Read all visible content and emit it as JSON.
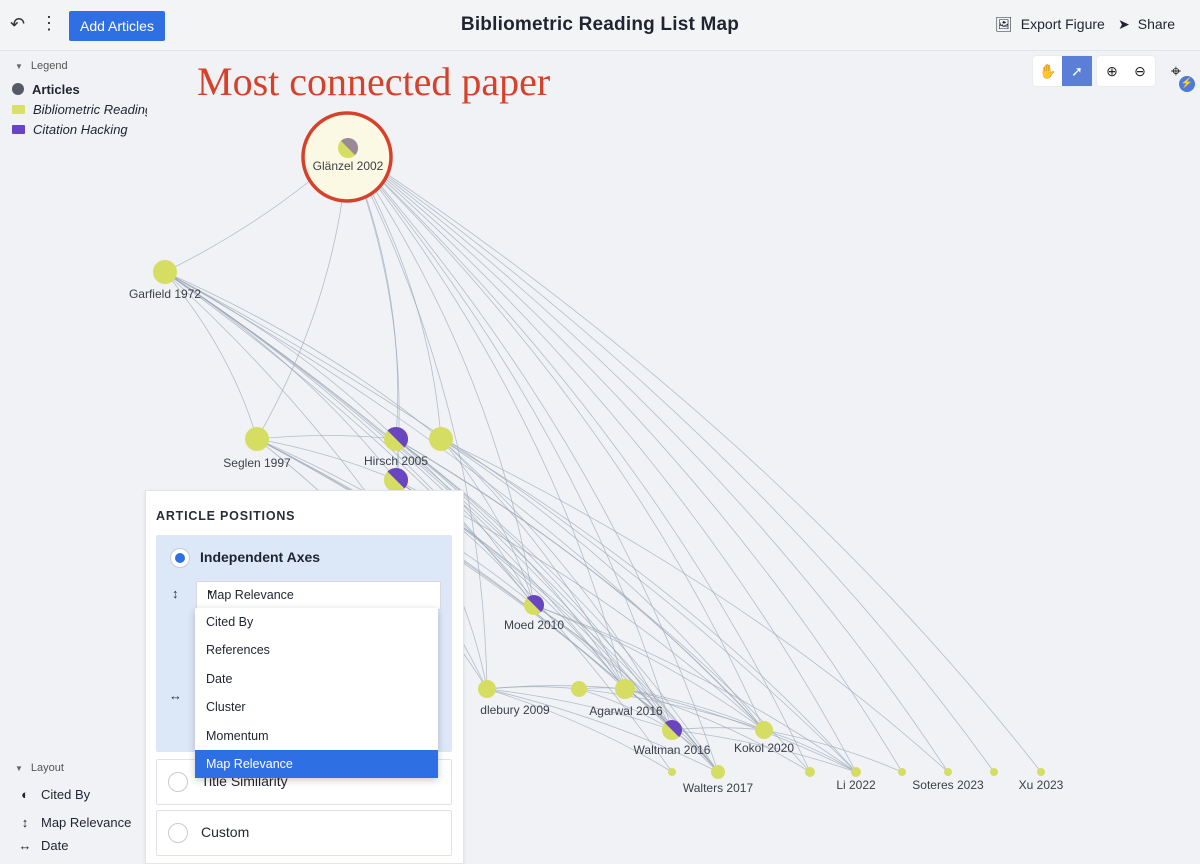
{
  "header": {
    "add_articles_label": "Add Articles",
    "title": "Bibliometric Reading List Map",
    "export_label": "Export Figure",
    "share_label": "Share"
  },
  "legend": {
    "title": "Legend",
    "items": [
      {
        "label": "Articles",
        "icon": "dot-icon",
        "color": "#555a66"
      },
      {
        "label": "Bibliometric Reading",
        "icon": "folder-icon",
        "color": "#d8e06a"
      },
      {
        "label": "Citation Hacking",
        "icon": "folder-icon",
        "color": "#6a45c2"
      }
    ]
  },
  "annotation": {
    "text": "Most connected paper",
    "color": "#d7402b"
  },
  "graph": {
    "colors": {
      "reading": "#d5de63",
      "hacking": "#6a45c2",
      "edge": "#9aa7b7",
      "highlight": "#d7402b"
    },
    "nodes": [
      {
        "label": "Glänzel 2002",
        "type": "split"
      },
      {
        "label": "Garfield 1972",
        "type": "reading"
      },
      {
        "label": "Seglen 1997",
        "type": "reading"
      },
      {
        "label": "Hirsch 2005",
        "type": "split"
      },
      {
        "label": "",
        "type": "reading"
      },
      {
        "label": "",
        "type": "split"
      },
      {
        "label": "Moed 2010",
        "type": "split"
      },
      {
        "label": "dlebury 2009",
        "type": "reading"
      },
      {
        "label": "",
        "type": "reading"
      },
      {
        "label": "Agarwal 2016",
        "type": "reading"
      },
      {
        "label": "Waltman 2016",
        "type": "split"
      },
      {
        "label": "Kokol 2020",
        "type": "reading"
      },
      {
        "label": "Walters 2017",
        "type": "reading"
      },
      {
        "label": "",
        "type": "reading"
      },
      {
        "label": "",
        "type": "reading"
      },
      {
        "label": "Li 2022",
        "type": "reading"
      },
      {
        "label": "",
        "type": "reading"
      },
      {
        "label": "Soteres 2023",
        "type": "reading"
      },
      {
        "label": "",
        "type": "reading"
      },
      {
        "label": "Xu 2023",
        "type": "reading"
      }
    ]
  },
  "article_positions": {
    "title": "ARTICLE POSITIONS",
    "options": [
      {
        "label": "Independent Axes",
        "selected": true
      },
      {
        "label": "Title Similarity",
        "selected": false
      },
      {
        "label": "Custom",
        "selected": false
      }
    ],
    "y_axis_value": "Map Relevance",
    "dropdown_options": [
      "Cited By",
      "References",
      "Date",
      "Cluster",
      "Momentum",
      "Map Relevance"
    ],
    "dropdown_selected": "Map Relevance"
  },
  "layout": {
    "title": "Layout",
    "items": [
      {
        "label": "Cited By",
        "icon": "circle-half-icon"
      },
      {
        "label": "Map Relevance",
        "icon": "vertical-axis-icon"
      },
      {
        "label": "Date",
        "icon": "horizontal-axis-icon"
      }
    ]
  }
}
